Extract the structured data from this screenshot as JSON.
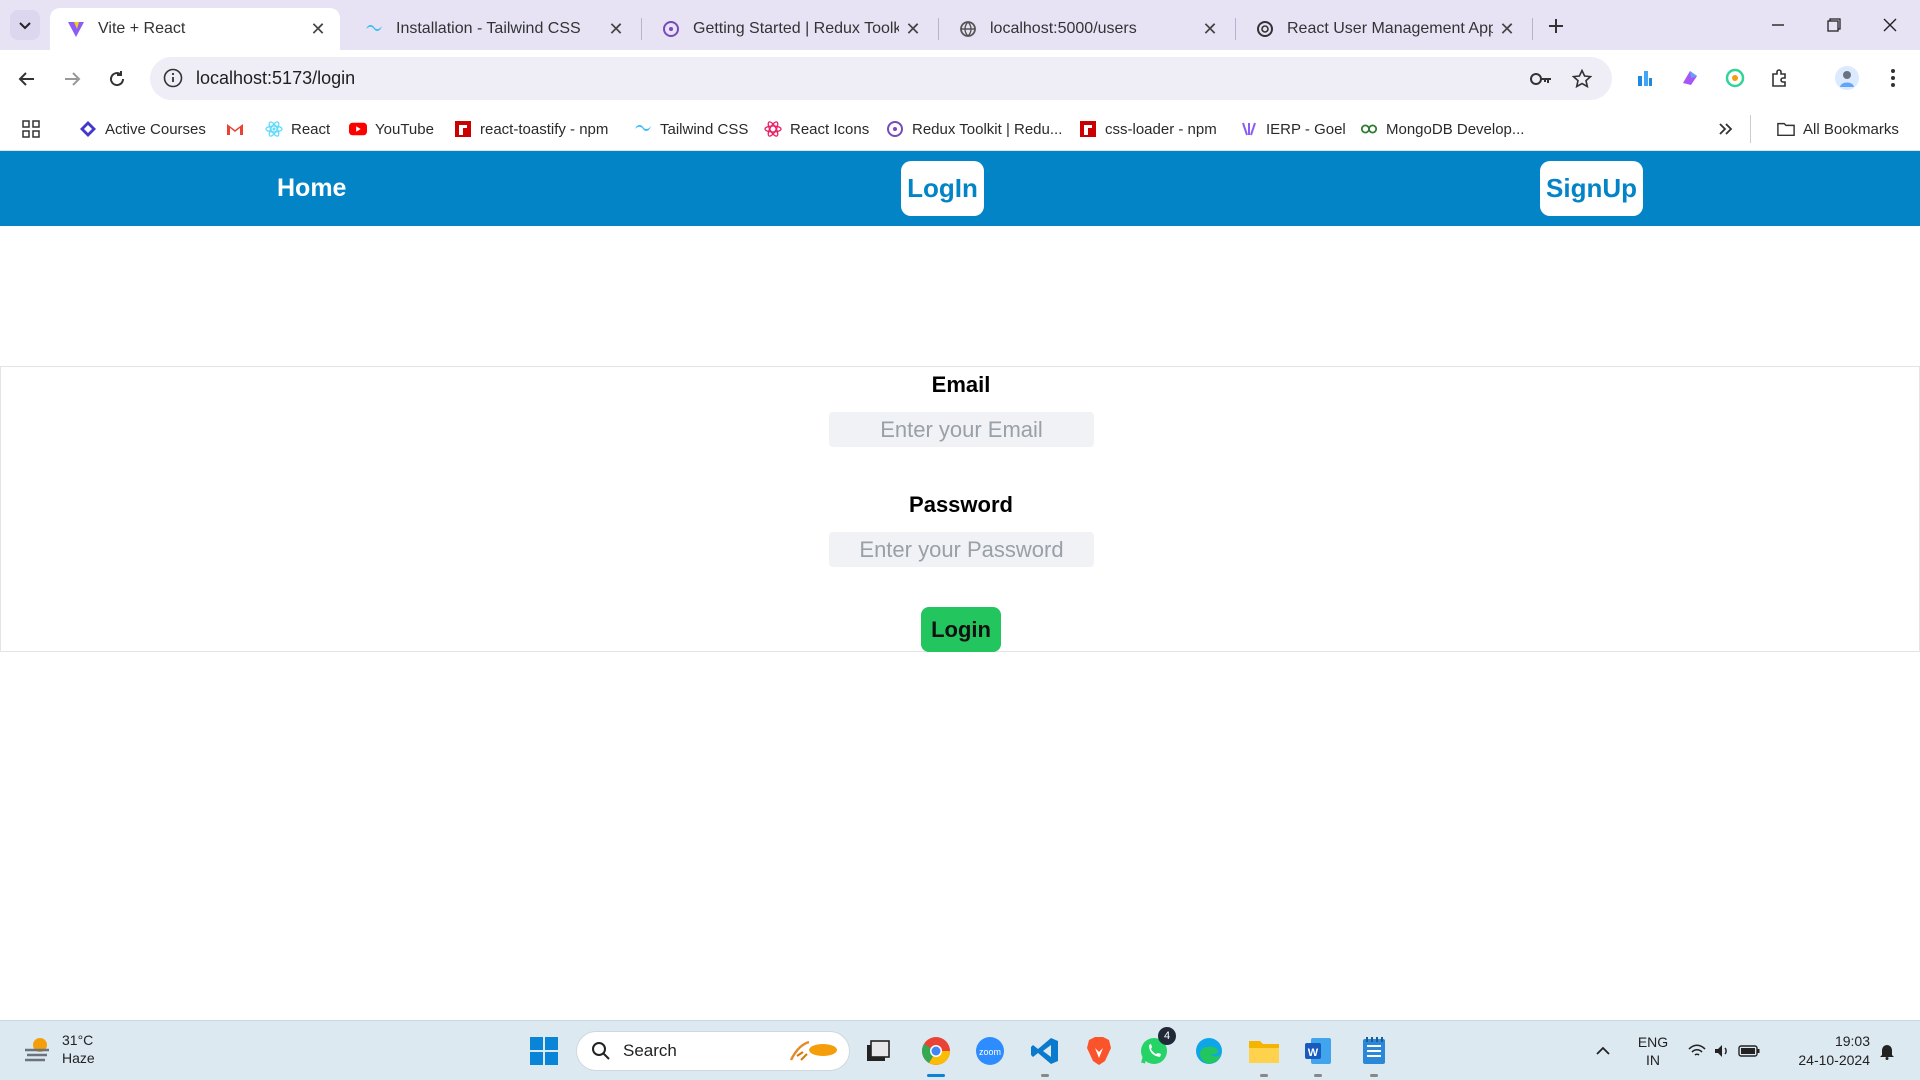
{
  "browser": {
    "tabs": [
      {
        "title": "Vite + React",
        "icon": "vite-icon",
        "active": true
      },
      {
        "title": "Installation - Tailwind CSS",
        "icon": "tailwind-icon",
        "active": false
      },
      {
        "title": "Getting Started | Redux Toolkit",
        "icon": "redux-icon",
        "active": false
      },
      {
        "title": "localhost:5000/users",
        "icon": "globe-icon",
        "active": false
      },
      {
        "title": "React User Management App",
        "icon": "openai-icon",
        "active": false
      }
    ],
    "url": "localhost:5173/login",
    "bookmarks": [
      {
        "label": "Active Courses",
        "icon": "courses-icon"
      },
      {
        "label": "",
        "icon": "gmail-icon"
      },
      {
        "label": "React",
        "icon": "react-icon"
      },
      {
        "label": "YouTube",
        "icon": "youtube-icon"
      },
      {
        "label": "react-toastify - npm",
        "icon": "npm-icon"
      },
      {
        "label": "Tailwind CSS",
        "icon": "tailwind-icon"
      },
      {
        "label": "React Icons",
        "icon": "react-icons-icon"
      },
      {
        "label": "Redux Toolkit | Redu...",
        "icon": "redux-icon"
      },
      {
        "label": "css-loader - npm",
        "icon": "npm-icon"
      },
      {
        "label": "IERP - Goel",
        "icon": "ierp-icon"
      },
      {
        "label": "MongoDB Develop...",
        "icon": "mongodb-icon"
      }
    ],
    "all_bookmarks_label": "All Bookmarks"
  },
  "app": {
    "nav": {
      "home": "Home",
      "login": "LogIn",
      "signup": "SignUp"
    },
    "form": {
      "email_label": "Email",
      "email_placeholder": "Enter your Email",
      "password_label": "Password",
      "password_placeholder": "Enter your Password",
      "submit_label": "Login"
    },
    "colors": {
      "nav_bg": "#0284c7",
      "button_green": "#22c55e"
    }
  },
  "taskbar": {
    "weather_temp": "31°C",
    "weather_desc": "Haze",
    "search_label": "Search",
    "whatsapp_badge": "4",
    "lang_top": "ENG",
    "lang_bottom": "IN",
    "time": "19:03",
    "date": "24-10-2024"
  }
}
